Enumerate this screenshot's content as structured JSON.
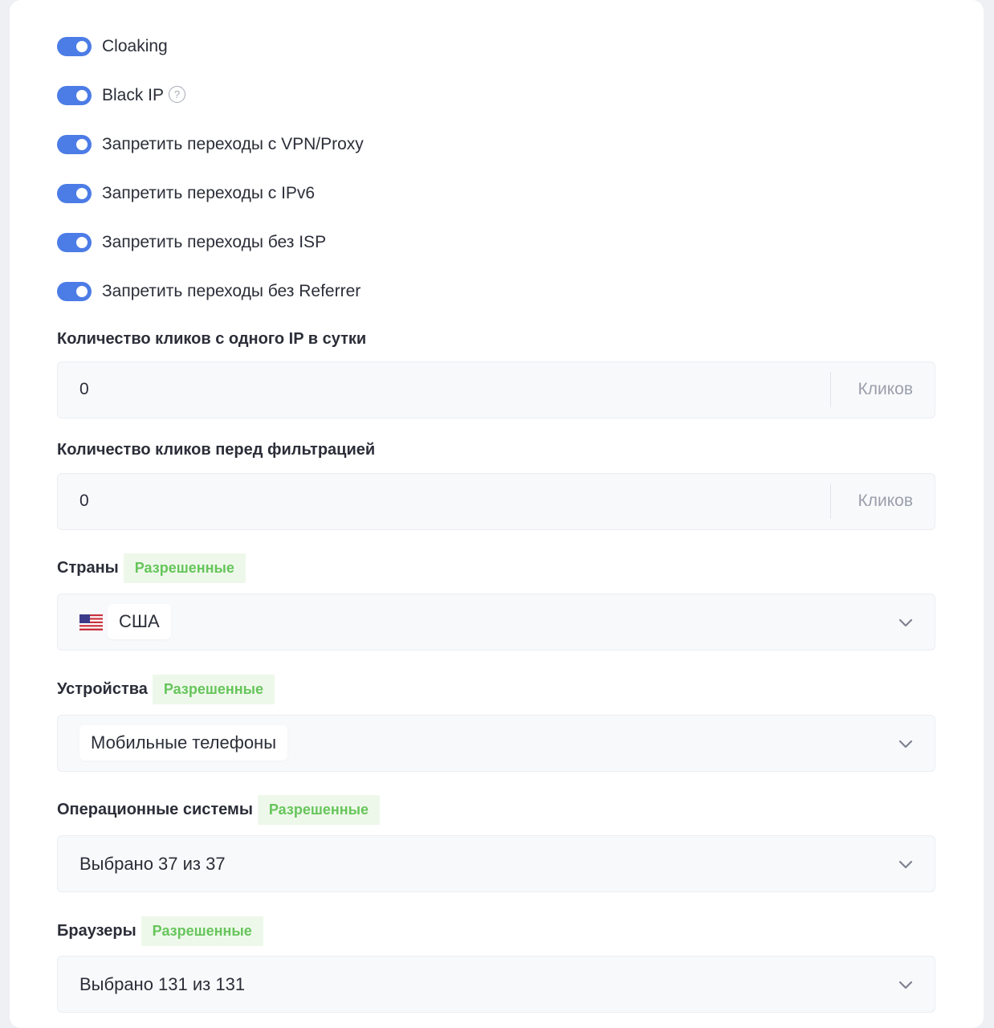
{
  "toggles": [
    {
      "label": "Cloaking",
      "on": true
    },
    {
      "label": "Black IP",
      "on": true,
      "help_icon": "question-circle-icon"
    },
    {
      "label": "Запретить переходы с VPN/Proxy",
      "on": true
    },
    {
      "label": "Запретить переходы с IPv6",
      "on": true
    },
    {
      "label": "Запретить переходы без ISP",
      "on": true
    },
    {
      "label": "Запретить переходы без Referrer",
      "on": true
    }
  ],
  "clicks_per_ip": {
    "label": "Количество кликов с одного IP в сутки",
    "value": "0",
    "unit": "Кликов"
  },
  "clicks_before_filter": {
    "label": "Количество кликов перед фильтрацией",
    "value": "0",
    "unit": "Кликов"
  },
  "countries": {
    "label": "Страны",
    "badge": "Разрешенные",
    "selected": "США",
    "flag_icon": "us-flag-icon"
  },
  "devices": {
    "label": "Устройства",
    "badge": "Разрешенные",
    "selected": "Мобильные телефоны"
  },
  "os": {
    "label": "Операционные системы",
    "badge": "Разрешенные",
    "summary": "Выбрано 37 из 37"
  },
  "browsers": {
    "label": "Браузеры",
    "badge": "Разрешенные",
    "summary": "Выбрано 131 из 131"
  },
  "colors": {
    "toggle_on": "#4c7ce6",
    "badge_text": "#66c55b",
    "badge_bg": "#eef8ea"
  }
}
